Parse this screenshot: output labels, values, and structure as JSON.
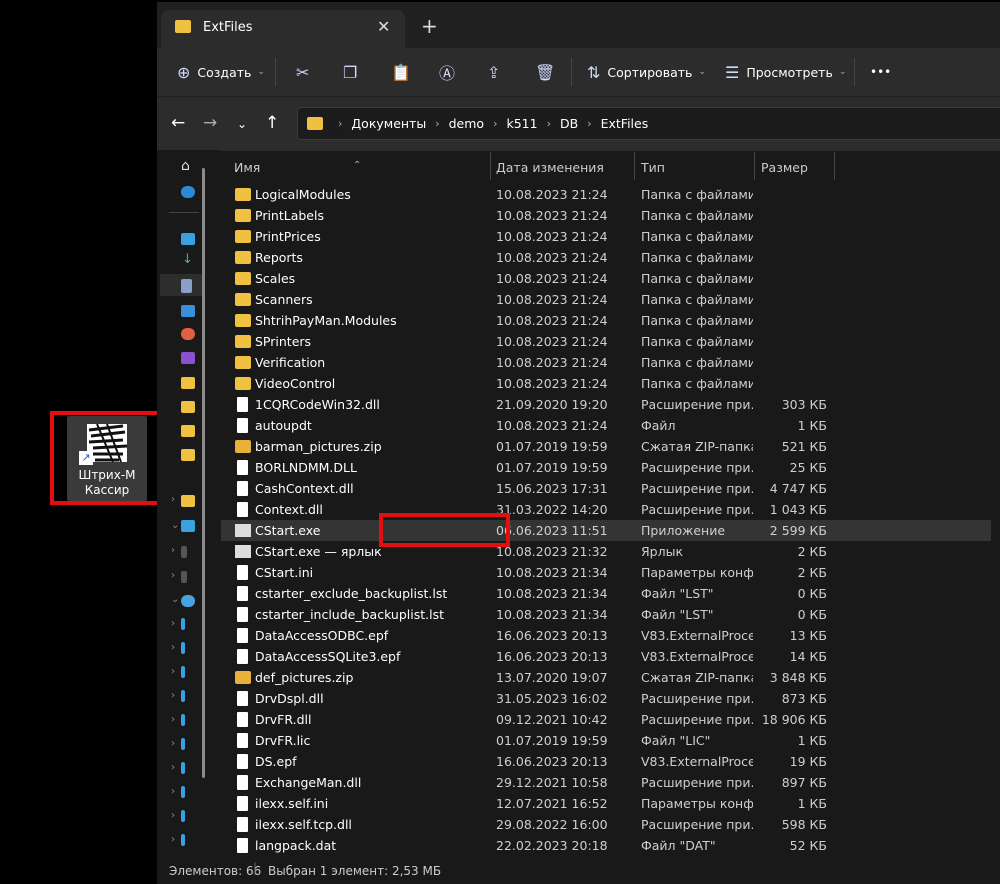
{
  "desktop": {
    "shortcut_label": "Штрих-М Кассир"
  },
  "window": {
    "tab_title": "ExtFiles",
    "toolbar": {
      "create": "Создать",
      "sort": "Сортировать",
      "view": "Просмотреть",
      "more": "•••"
    },
    "breadcrumb": [
      "Документы",
      "demo",
      "k511",
      "DB",
      "ExtFiles"
    ],
    "columns": {
      "name": "Имя",
      "date": "Дата изменения",
      "type": "Тип",
      "size": "Размер"
    },
    "files": [
      {
        "name": "LogicalModules",
        "date": "10.08.2023 21:24",
        "type": "Папка с файлами",
        "size": "",
        "kind": "folder"
      },
      {
        "name": "PrintLabels",
        "date": "10.08.2023 21:24",
        "type": "Папка с файлами",
        "size": "",
        "kind": "folder"
      },
      {
        "name": "PrintPrices",
        "date": "10.08.2023 21:24",
        "type": "Папка с файлами",
        "size": "",
        "kind": "folder"
      },
      {
        "name": "Reports",
        "date": "10.08.2023 21:24",
        "type": "Папка с файлами",
        "size": "",
        "kind": "folder"
      },
      {
        "name": "Scales",
        "date": "10.08.2023 21:24",
        "type": "Папка с файлами",
        "size": "",
        "kind": "folder"
      },
      {
        "name": "Scanners",
        "date": "10.08.2023 21:24",
        "type": "Папка с файлами",
        "size": "",
        "kind": "folder"
      },
      {
        "name": "ShtrihPayMan.Modules",
        "date": "10.08.2023 21:24",
        "type": "Папка с файлами",
        "size": "",
        "kind": "folder"
      },
      {
        "name": "SPrinters",
        "date": "10.08.2023 21:24",
        "type": "Папка с файлами",
        "size": "",
        "kind": "folder"
      },
      {
        "name": "Verification",
        "date": "10.08.2023 21:24",
        "type": "Папка с файлами",
        "size": "",
        "kind": "folder"
      },
      {
        "name": "VideoControl",
        "date": "10.08.2023 21:24",
        "type": "Папка с файлами",
        "size": "",
        "kind": "folder"
      },
      {
        "name": "1CQRCodeWin32.dll",
        "date": "21.09.2020 19:20",
        "type": "Расширение при...",
        "size": "303 КБ",
        "kind": "file"
      },
      {
        "name": "autoupdt",
        "date": "10.08.2023 21:24",
        "type": "Файл",
        "size": "1 КБ",
        "kind": "file"
      },
      {
        "name": "barman_pictures.zip",
        "date": "01.07.2019 19:59",
        "type": "Сжатая ZIP-папка",
        "size": "521 КБ",
        "kind": "zip"
      },
      {
        "name": "BORLNDMM.DLL",
        "date": "01.07.2019 19:59",
        "type": "Расширение при...",
        "size": "25 КБ",
        "kind": "file"
      },
      {
        "name": "CashContext.dll",
        "date": "15.06.2023 17:31",
        "type": "Расширение при...",
        "size": "4 747 КБ",
        "kind": "file"
      },
      {
        "name": "Context.dll",
        "date": "31.03.2022 14:20",
        "type": "Расширение при...",
        "size": "1 043 КБ",
        "kind": "file"
      },
      {
        "name": "CStart.exe",
        "date": "06.06.2023 11:51",
        "type": "Приложение",
        "size": "2 599 КБ",
        "kind": "exe"
      },
      {
        "name": "CStart.exe — ярлык",
        "date": "10.08.2023 21:32",
        "type": "Ярлык",
        "size": "2 КБ",
        "kind": "exe"
      },
      {
        "name": "CStart.ini",
        "date": "10.08.2023 21:34",
        "type": "Параметры конф...",
        "size": "2 КБ",
        "kind": "file"
      },
      {
        "name": "cstarter_exclude_backuplist.lst",
        "date": "10.08.2023 21:34",
        "type": "Файл \"LST\"",
        "size": "0 КБ",
        "kind": "file"
      },
      {
        "name": "cstarter_include_backuplist.lst",
        "date": "10.08.2023 21:34",
        "type": "Файл \"LST\"",
        "size": "0 КБ",
        "kind": "file"
      },
      {
        "name": "DataAccessODBC.epf",
        "date": "16.06.2023 20:13",
        "type": "V83.ExternalProce...",
        "size": "13 КБ",
        "kind": "file"
      },
      {
        "name": "DataAccessSQLite3.epf",
        "date": "16.06.2023 20:13",
        "type": "V83.ExternalProce...",
        "size": "14 КБ",
        "kind": "file"
      },
      {
        "name": "def_pictures.zip",
        "date": "13.07.2020 19:07",
        "type": "Сжатая ZIP-папка",
        "size": "3 848 КБ",
        "kind": "zip"
      },
      {
        "name": "DrvDspl.dll",
        "date": "31.05.2023 16:02",
        "type": "Расширение при...",
        "size": "873 КБ",
        "kind": "file"
      },
      {
        "name": "DrvFR.dll",
        "date": "09.12.2021 10:42",
        "type": "Расширение при...",
        "size": "18 906 КБ",
        "kind": "file"
      },
      {
        "name": "DrvFR.lic",
        "date": "01.07.2019 19:59",
        "type": "Файл \"LIC\"",
        "size": "1 КБ",
        "kind": "file"
      },
      {
        "name": "DS.epf",
        "date": "16.06.2023 20:13",
        "type": "V83.ExternalProce...",
        "size": "19 КБ",
        "kind": "file"
      },
      {
        "name": "ExchangeMan.dll",
        "date": "29.12.2021 10:58",
        "type": "Расширение при...",
        "size": "897 КБ",
        "kind": "file"
      },
      {
        "name": "ilexx.self.ini",
        "date": "12.07.2021 16:52",
        "type": "Параметры конф...",
        "size": "1 КБ",
        "kind": "file"
      },
      {
        "name": "ilexx.self.tcp.dll",
        "date": "29.08.2022 16:00",
        "type": "Расширение при...",
        "size": "598 КБ",
        "kind": "file"
      },
      {
        "name": "langpack.dat",
        "date": "22.02.2023 20:18",
        "type": "Файл \"DAT\"",
        "size": "52 КБ",
        "kind": "file"
      }
    ],
    "selected_index": 16,
    "status": {
      "count": "Элементов: 66",
      "selection": "Выбран 1 элемент: 2,53 МБ"
    }
  }
}
